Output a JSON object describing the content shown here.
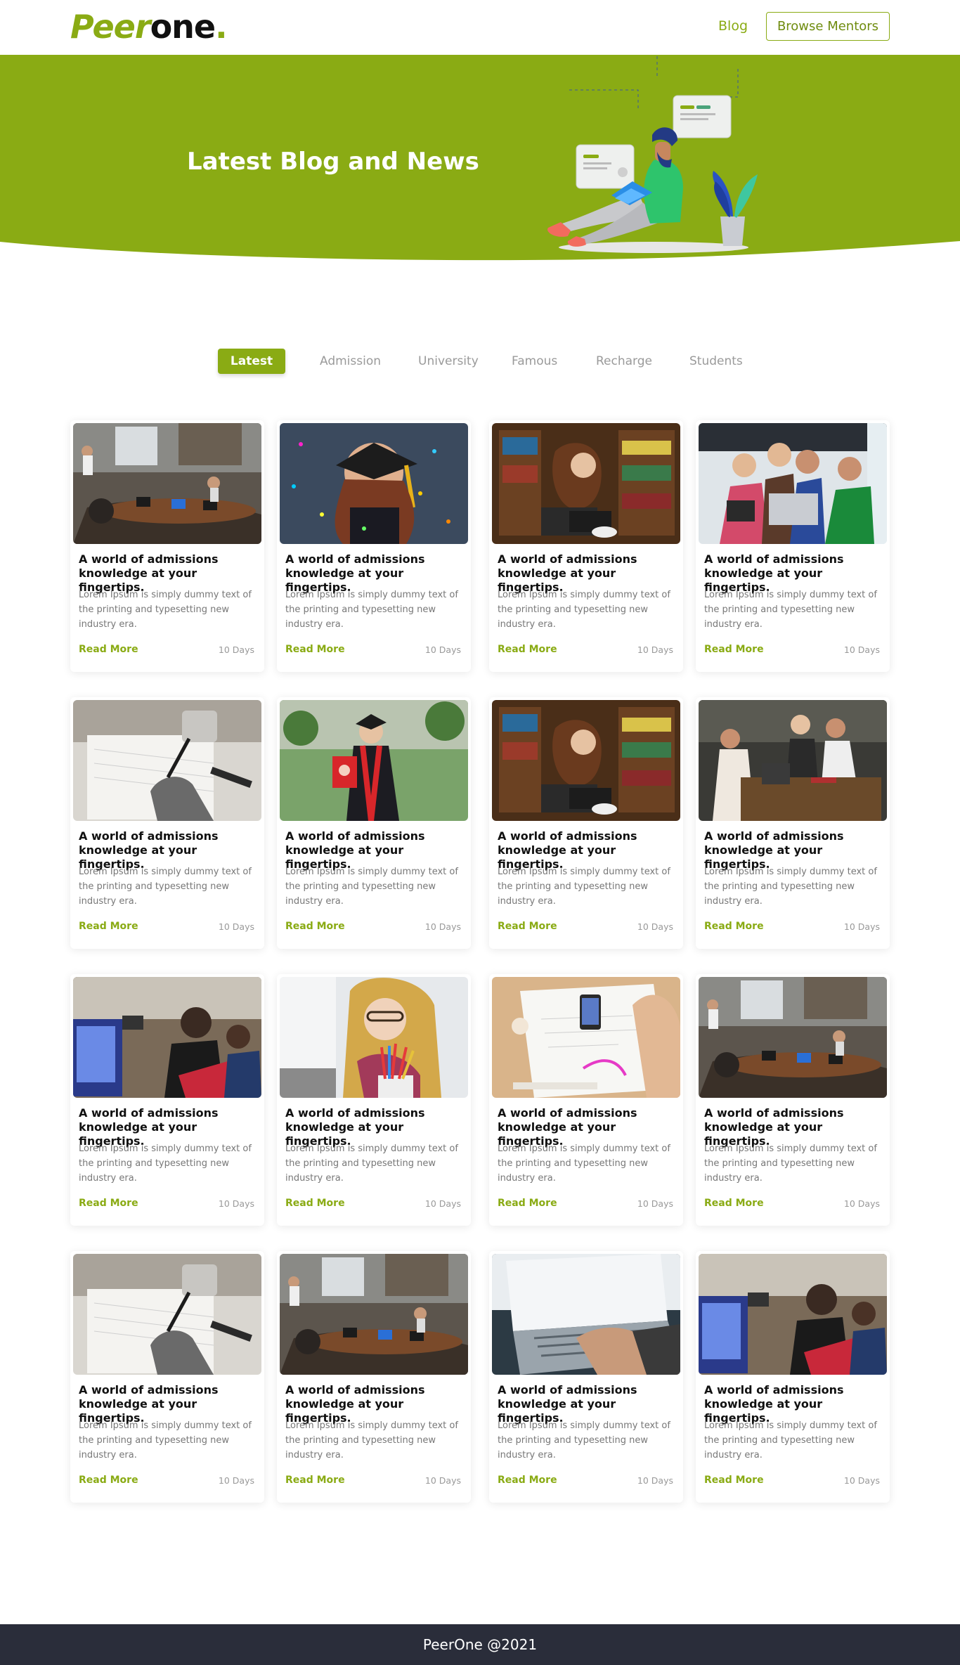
{
  "header": {
    "logo_peer": "Peer",
    "logo_one": "one",
    "logo_dot": ".",
    "nav_blog": "Blog",
    "browse_mentors": "Browse Mentors"
  },
  "hero": {
    "title": "Latest Blog and News"
  },
  "tabs": [
    {
      "label": "Latest",
      "active": true
    },
    {
      "label": "Admission"
    },
    {
      "label": "University"
    },
    {
      "label": "Famous"
    },
    {
      "label": "Recharge"
    },
    {
      "label": "Students"
    }
  ],
  "cards": [
    {
      "title": "A world of admissions knowledge at your fingertips.",
      "text": "Lorem Ipsum is simply dummy text of the printing and typesetting new industry era.",
      "link": "Read More",
      "age": "10 Days",
      "image": "classroom-meeting"
    },
    {
      "title": "A world of admissions knowledge at your fingertips.",
      "text": "Lorem Ipsum is simply dummy text of the printing and typesetting new industry era.",
      "link": "Read More",
      "age": "10 Days",
      "image": "graduate-confetti"
    },
    {
      "title": "A world of admissions knowledge at your fingertips.",
      "text": "Lorem Ipsum is simply dummy text of the printing and typesetting new industry era.",
      "link": "Read More",
      "age": "10 Days",
      "image": "library-laptop"
    },
    {
      "title": "A world of admissions knowledge at your fingertips.",
      "text": "Lorem Ipsum is simply dummy text of the printing and typesetting new industry era.",
      "link": "Read More",
      "age": "10 Days",
      "image": "group-laptop"
    },
    {
      "title": "A world of admissions knowledge at your fingertips.",
      "text": "Lorem Ipsum is simply dummy text of the printing and typesetting new industry era.",
      "link": "Read More",
      "age": "10 Days",
      "image": "writing-desk"
    },
    {
      "title": "A world of admissions knowledge at your fingertips.",
      "text": "Lorem Ipsum is simply dummy text of the printing and typesetting new industry era.",
      "link": "Read More",
      "age": "10 Days",
      "image": "graduate-gown"
    },
    {
      "title": "A world of admissions knowledge at your fingertips.",
      "text": "Lorem Ipsum is simply dummy text of the printing and typesetting new industry era.",
      "link": "Read More",
      "age": "10 Days",
      "image": "library-laptop"
    },
    {
      "title": "A world of admissions knowledge at your fingertips.",
      "text": "Lorem Ipsum is simply dummy text of the printing and typesetting new industry era.",
      "link": "Read More",
      "age": "10 Days",
      "image": "cafe-study"
    },
    {
      "title": "A world of admissions knowledge at your fingertips.",
      "text": "Lorem Ipsum is simply dummy text of the printing and typesetting new industry era.",
      "link": "Read More",
      "age": "10 Days",
      "image": "computer-lab"
    },
    {
      "title": "A world of admissions knowledge at your fingertips.",
      "text": "Lorem Ipsum is simply dummy text of the printing and typesetting new industry era.",
      "link": "Read More",
      "age": "10 Days",
      "image": "pencil-student"
    },
    {
      "title": "A world of admissions knowledge at your fingertips.",
      "text": "Lorem Ipsum is simply dummy text of the printing and typesetting new industry era.",
      "link": "Read More",
      "age": "10 Days",
      "image": "design-sketch"
    },
    {
      "title": "A world of admissions knowledge at your fingertips.",
      "text": "Lorem Ipsum is simply dummy text of the printing and typesetting new industry era.",
      "link": "Read More",
      "age": "10 Days",
      "image": "classroom-meeting"
    },
    {
      "title": "A world of admissions knowledge at your fingertips.",
      "text": "Lorem Ipsum is simply dummy text of the printing and typesetting new industry era.",
      "link": "Read More",
      "age": "10 Days",
      "image": "writing-desk"
    },
    {
      "title": "A world of admissions knowledge at your fingertips.",
      "text": "Lorem Ipsum is simply dummy text of the printing and typesetting new industry era.",
      "link": "Read More",
      "age": "10 Days",
      "image": "classroom-meeting"
    },
    {
      "title": "A world of admissions knowledge at your fingertips.",
      "text": "Lorem Ipsum is simply dummy text of the printing and typesetting new industry era.",
      "link": "Read More",
      "age": "10 Days",
      "image": "typing-laptop"
    },
    {
      "title": "A world of admissions knowledge at your fingertips.",
      "text": "Lorem Ipsum is simply dummy text of the printing and typesetting new industry era.",
      "link": "Read More",
      "age": "10 Days",
      "image": "computer-lab"
    }
  ],
  "footer": {
    "text": "PeerOne @2021"
  },
  "colors": {
    "brand": "#8aab14",
    "footer_bg": "#2a2d3a"
  }
}
